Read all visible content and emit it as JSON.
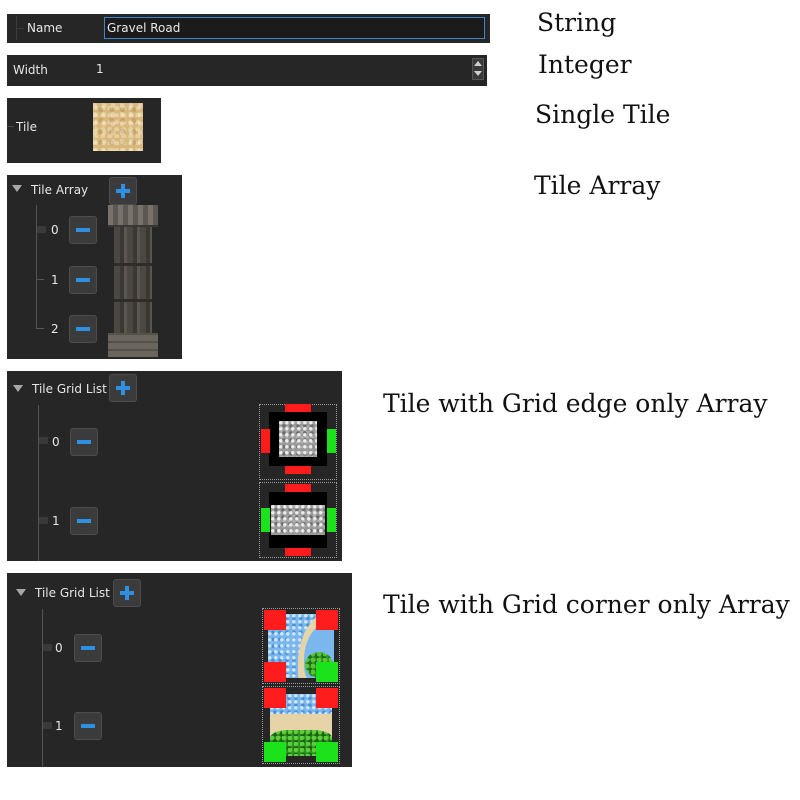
{
  "name_row": {
    "label": "Name",
    "value": "Gravel Road",
    "caption": "String"
  },
  "width_row": {
    "label": "Width",
    "value": "1",
    "caption": "Integer"
  },
  "tile_row": {
    "label": "Tile",
    "caption": "Single Tile"
  },
  "tile_array": {
    "label": "Tile Array",
    "caption": "Tile Array",
    "indices": [
      "0",
      "1",
      "2"
    ]
  },
  "grid_edge": {
    "label": "Tile Grid List",
    "caption": "Tile with Grid edge only Array",
    "indices": [
      "0",
      "1"
    ]
  },
  "grid_corner": {
    "label": "Tile Grid List",
    "caption": "Tile with Grid corner only Array",
    "indices": [
      "0",
      "1"
    ]
  },
  "colors": {
    "panel": "#262626",
    "accent_blue": "#2f8fe0",
    "grid_red": "#ff1c1c",
    "grid_green": "#1be21b"
  }
}
